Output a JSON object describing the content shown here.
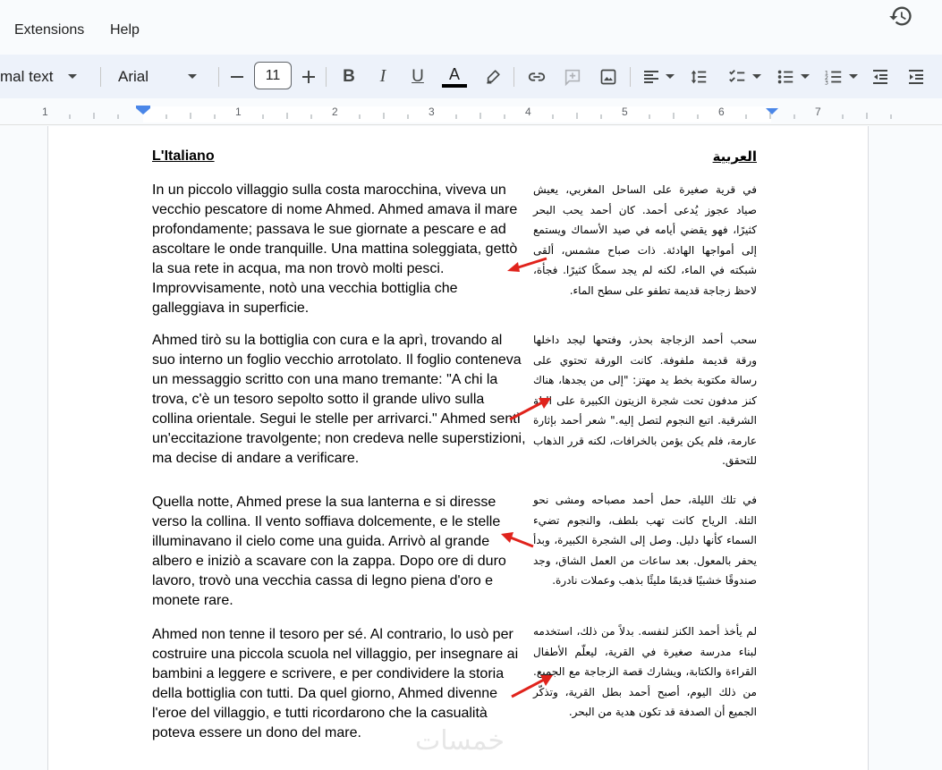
{
  "menu": {
    "items": [
      "Extensions",
      "Help"
    ]
  },
  "toolbar": {
    "style_value": "mal text",
    "font_value": "Arial",
    "font_size": "11",
    "text_color": "#000000",
    "icons": [
      "minus-icon",
      "plus-icon",
      "bold-icon",
      "italic-icon",
      "underline-icon",
      "text-color-icon",
      "highlight-icon",
      "link-icon",
      "add-comment-icon",
      "insert-image-icon",
      "align-left-icon",
      "line-spacing-icon",
      "checklist-icon",
      "bulleted-list-icon",
      "numbered-list-icon",
      "decrease-indent-icon",
      "increase-indent-icon"
    ],
    "bold_label": "B",
    "italic_label": "I",
    "underline_label": "U",
    "text_color_label": "A"
  },
  "ruler": {
    "numbers": [
      "1",
      "1",
      "2",
      "3",
      "4",
      "5",
      "6",
      "7"
    ]
  },
  "document": {
    "italian_heading": "L'Italiano",
    "arabic_heading": "العربية",
    "italian_paragraphs": [
      "In un piccolo villaggio sulla costa marocchina, viveva un vecchio pescatore di nome Ahmed. Ahmed amava il mare profondamente; passava le sue giornate a pescare e ad ascoltare le onde tranquille. Una mattina soleggiata, gettò la sua rete in acqua, ma non trovò molti pesci. Improvvisamente, notò una vecchia bottiglia che galleggiava in superficie.",
      "Ahmed tirò su la bottiglia con cura e la aprì, trovando al suo interno un foglio vecchio arrotolato. Il foglio conteneva un messaggio scritto con una mano tremante: \"A chi la trova, c'è un tesoro sepolto sotto il grande ulivo sulla collina orientale. Segui le stelle per arrivarci.\" Ahmed sentì un'eccitazione travolgente; non credeva nelle superstizioni, ma decise di andare a verificare.",
      "Quella notte, Ahmed prese la sua lanterna e si diresse verso la collina. Il vento soffiava dolcemente, e le stelle illuminavano il cielo come una guida. Arrivò al grande albero e iniziò a scavare con la zappa. Dopo ore di duro lavoro, trovò una vecchia cassa di legno piena d'oro e monete rare.",
      "Ahmed non tenne il tesoro per sé. Al contrario, lo usò per costruire una piccola scuola nel villaggio, per insegnare ai bambini a leggere e scrivere, e per condividere la storia della bottiglia con tutti. Da quel giorno, Ahmed divenne l'eroe del villaggio, e tutti ricordarono che la casualità poteva essere un dono del mare."
    ],
    "arabic_paragraphs": [
      "في قرية صغيرة على الساحل المغربي، يعيش صياد عجوز يُدعى أحمد. كان أحمد يحب البحر كثيرًا، فهو يقضي أيامه في صيد الأسماك ويستمع إلى أمواجها الهادئة. ذات صباح مشمس، ألقى شبكته في الماء، لكنه لم يجد سمكًا كثيرًا. فجأة، لاحظ زجاجة قديمة تطفو على سطح الماء.",
      "سحب أحمد الزجاجة بحذر، وفتحها ليجد داخلها ورقة قديمة ملفوفة. كانت الورقة تحتوي على رسالة مكتوبة بخط يد مهتز: \"إلى من يجدها، هناك كنز مدفون تحت شجرة الزيتون الكبيرة على التلة الشرقية. اتبع النجوم لتصل إليه.\" شعر أحمد بإثارة عارمة، فلم يكن يؤمن بالخرافات، لكنه قرر الذهاب للتحقق.",
      "في تلك الليلة، حمل أحمد مصباحه ومشى نحو التلة. الرياح كانت تهب بلطف، والنجوم تضيء السماء كأنها دليل. وصل إلى الشجرة الكبيرة، وبدأ يحفر بالمعول. بعد ساعات من العمل الشاق، وجد صندوقًا خشبيًا قديمًا مليئًا بذهب وعملات نادرة.",
      "لم يأخذ أحمد الكنز لنفسه. بدلاً من ذلك، استخدمه لبناء مدرسة صغيرة في القرية، ليعلّم الأطفال القراءة والكتابة، ويشارك قصة الزجاجة مع الجميع. من ذلك اليوم، أصبح أحمد بطل القرية، وتذكّر الجميع أن الصدفة قد تكون هدية من البحر."
    ],
    "watermark": "خمسات"
  },
  "colors": {
    "arrow": "#e0231c",
    "toolbar_bg": "#edf2fa",
    "page_bg": "#ffffff"
  }
}
